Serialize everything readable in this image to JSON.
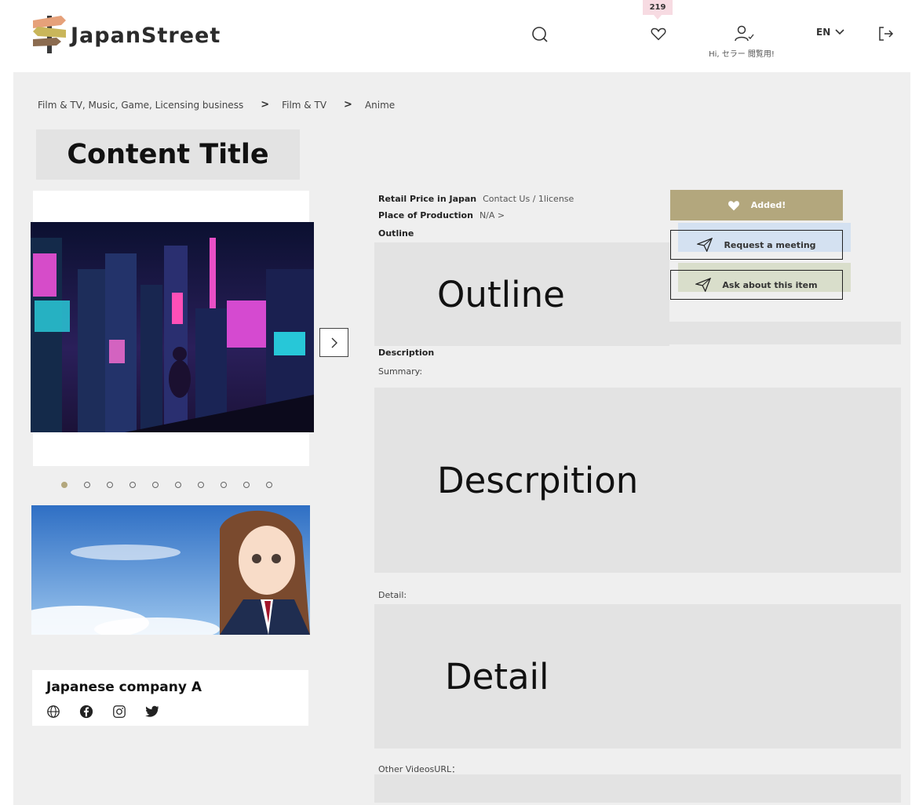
{
  "header": {
    "logo_text": "JapanStreet",
    "favorites_count": "219",
    "greeting": "Hi, セラー 閲覧用!",
    "language": "EN"
  },
  "breadcrumb": {
    "items": [
      "Film & TV, Music, Game, Licensing business",
      "Film & TV",
      "Anime"
    ]
  },
  "content": {
    "title": "Content Title",
    "company_name": "Japanese company A"
  },
  "info": {
    "retail_price_label": "Retail Price in Japan",
    "retail_price_value": "Contact Us / 1license",
    "place_label": "Place of Production",
    "place_value": "N/A >",
    "outline_label": "Outline",
    "outline_placeholder": "Outline",
    "description_label": "Description",
    "summary_label": "Summary:",
    "description_placeholder": "Descrpition",
    "detail_label": "Detail:",
    "detail_placeholder": "Detail",
    "other_videos_label": "Other VideosURL："
  },
  "actions": {
    "added_label": "Added!",
    "request_meeting_label": "Request a meeting",
    "ask_label": "Ask about this item"
  },
  "gallery": {
    "slide_count": 10,
    "active_index": 0
  },
  "colors": {
    "accent": "#b3a77d",
    "favorite_badge": "#f7dbe2"
  }
}
